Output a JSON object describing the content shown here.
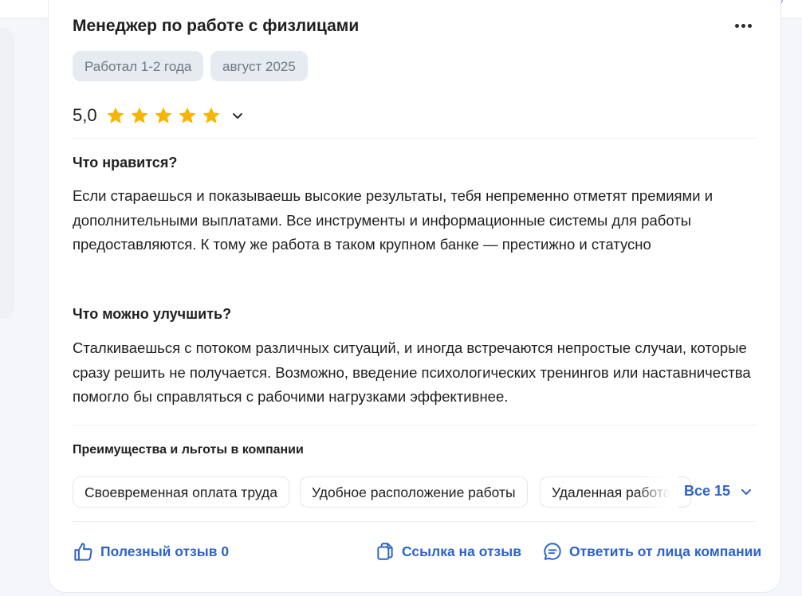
{
  "review": {
    "title": "Менеджер по работе с физлицами",
    "tags": [
      "Работал 1-2 года",
      "август 2025"
    ],
    "rating": "5,0",
    "stars": 5,
    "likes_heading": "Что нравится?",
    "likes_text": "Если стараешься и показываешь высокие результаты, тебя непременно отметят премиями и дополнительными выплатами. Все инструменты и информационные системы для работы предоставляются. К тому же работа в таком крупном банке — престижно и статусно",
    "improve_heading": "Что можно улучшить?",
    "improve_text": "Сталкиваешься с потоком различных ситуаций, и иногда встречаются непростые случаи, которые сразу решить не получается. Возможно, введение психологических тренингов или наставничества помогло бы справляться с рабочими нагрузками эффективнее."
  },
  "benefits": {
    "title": "Преимущества и льготы в компании",
    "chips": [
      "Своевременная оплата труда",
      "Удобное расположение работы",
      "Удаленная работа"
    ],
    "all_label": "Все 15"
  },
  "actions": {
    "useful": "Полезный отзыв 0",
    "link": "Ссылка на отзыв",
    "reply": "Ответить от лица компании"
  },
  "colors": {
    "accent": "#2d63c9",
    "star": "#f7b500",
    "tag_bg": "#e6ebf2"
  }
}
